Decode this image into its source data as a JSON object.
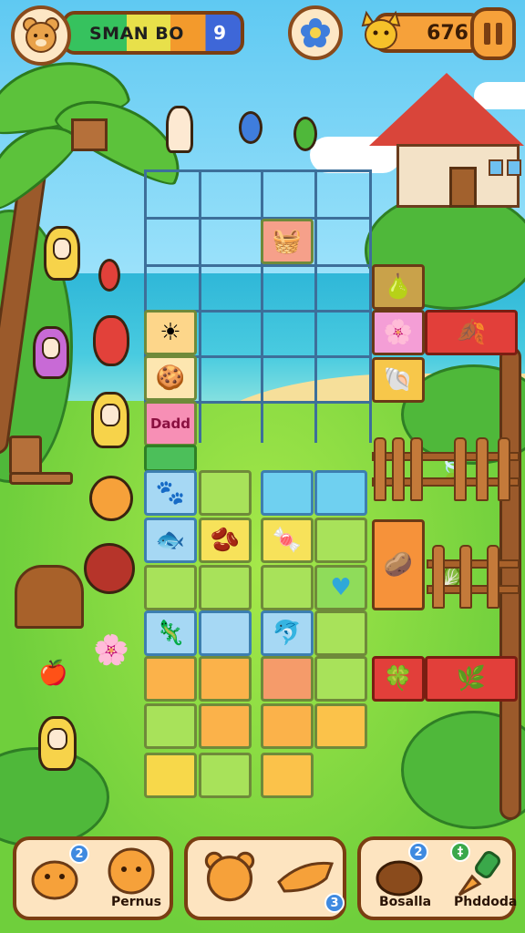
{
  "hud": {
    "player_name": "SMAN BO",
    "name_bar_icon": "9",
    "score": "676",
    "center_icon": "flower-icon",
    "pause_icon": "pause-icon"
  },
  "board": {
    "tiles": [
      {
        "name": "tile-treasure-map",
        "glyph": "🧺",
        "color": "#f6a08a"
      },
      {
        "name": "tile-sun",
        "glyph": "☀",
        "color": "#fdd68a"
      },
      {
        "name": "tile-crackers",
        "glyph": "🍪",
        "color": "#fde6b0"
      },
      {
        "name": "tile-word",
        "text": "Dadd",
        "color": "#f78fb5"
      },
      {
        "name": "tile-animal",
        "glyph": "🐾",
        "color": "#a6d8f4"
      },
      {
        "name": "tile-fish",
        "glyph": "🐟",
        "color": "#a6d8f4"
      },
      {
        "name": "tile-bean",
        "glyph": "🫘",
        "color": "#f7e25a"
      },
      {
        "name": "tile-candy",
        "glyph": "🍬",
        "color": "#f7e25a"
      },
      {
        "name": "tile-heart",
        "glyph": "♥",
        "color": "#8fdc5a"
      },
      {
        "name": "tile-lizard",
        "glyph": "🦎",
        "color": "#a6d8f4"
      },
      {
        "name": "tile-dolphin",
        "glyph": "🐬",
        "color": "#a6d8f4"
      }
    ]
  },
  "side": {
    "items": [
      {
        "name": "side-tile-pear",
        "glyph": "🍐"
      },
      {
        "name": "side-tile-flower",
        "glyph": "🌸"
      },
      {
        "name": "side-tile-shell",
        "glyph": "🐚"
      },
      {
        "name": "side-tile-acorn",
        "glyph": "🥔"
      },
      {
        "name": "side-tile-clover",
        "glyph": "🍀"
      }
    ]
  },
  "panels": [
    {
      "label": "Pernus",
      "badge": "2"
    },
    {
      "label": "",
      "badge": "3"
    },
    {
      "label": "Bosalla",
      "label2": "Phddoda",
      "badge": "2",
      "badge2": "‡"
    }
  ],
  "colors": {
    "accent_brown": "#7a3e12",
    "panel_bg": "#fde4c0",
    "red_bar": "#e23f3a"
  }
}
